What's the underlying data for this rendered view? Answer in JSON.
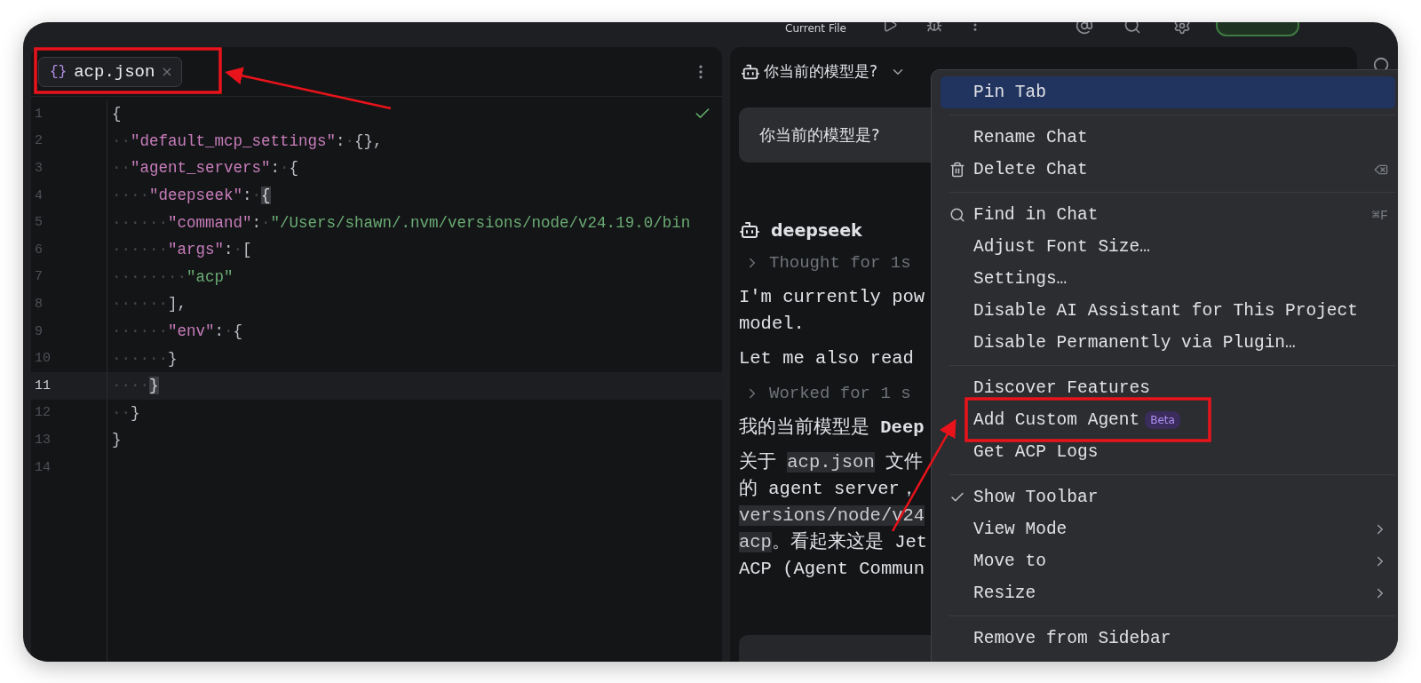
{
  "toolbar": {
    "run_config": "Current File"
  },
  "editor": {
    "tab": {
      "icon": "{}",
      "label": "acp.json",
      "selected": true
    },
    "lines": [
      {
        "number": "1",
        "current": false,
        "tokens": [
          {
            "kind": "punct",
            "text": "{"
          }
        ]
      },
      {
        "number": "2",
        "current": false,
        "tokens": [
          {
            "kind": "ws",
            "text": "··"
          },
          {
            "kind": "key",
            "text": "\"default_mcp_settings\""
          },
          {
            "kind": "punct",
            "text": ":"
          },
          {
            "kind": "ws",
            "text": "·"
          },
          {
            "kind": "punct",
            "text": "{},"
          }
        ]
      },
      {
        "number": "3",
        "current": false,
        "tokens": [
          {
            "kind": "ws",
            "text": "··"
          },
          {
            "kind": "key",
            "text": "\"agent_servers\""
          },
          {
            "kind": "punct",
            "text": ":"
          },
          {
            "kind": "ws",
            "text": "·"
          },
          {
            "kind": "punct",
            "text": "{"
          }
        ]
      },
      {
        "number": "4",
        "current": false,
        "tokens": [
          {
            "kind": "ws",
            "text": "····"
          },
          {
            "kind": "key",
            "text": "\"deepseek\""
          },
          {
            "kind": "punct",
            "text": ":"
          },
          {
            "kind": "ws",
            "text": "·"
          },
          {
            "kind": "match",
            "text": "{"
          }
        ]
      },
      {
        "number": "5",
        "current": false,
        "tokens": [
          {
            "kind": "ws",
            "text": "······"
          },
          {
            "kind": "key",
            "text": "\"command\""
          },
          {
            "kind": "punct",
            "text": ":"
          },
          {
            "kind": "ws",
            "text": "·"
          },
          {
            "kind": "string",
            "text": "\"/Users/shawn/.nvm/versions/node/v24.19.0/bin"
          }
        ]
      },
      {
        "number": "6",
        "current": false,
        "tokens": [
          {
            "kind": "ws",
            "text": "······"
          },
          {
            "kind": "key",
            "text": "\"args\""
          },
          {
            "kind": "punct",
            "text": ":"
          },
          {
            "kind": "ws",
            "text": "·"
          },
          {
            "kind": "punct",
            "text": "["
          }
        ]
      },
      {
        "number": "7",
        "current": false,
        "tokens": [
          {
            "kind": "ws",
            "text": "········"
          },
          {
            "kind": "string",
            "text": "\"acp\""
          }
        ]
      },
      {
        "number": "8",
        "current": false,
        "tokens": [
          {
            "kind": "ws",
            "text": "······"
          },
          {
            "kind": "punct",
            "text": "],"
          }
        ]
      },
      {
        "number": "9",
        "current": false,
        "tokens": [
          {
            "kind": "ws",
            "text": "······"
          },
          {
            "kind": "key",
            "text": "\"env\""
          },
          {
            "kind": "punct",
            "text": ":"
          },
          {
            "kind": "ws",
            "text": "·"
          },
          {
            "kind": "punct",
            "text": "{"
          }
        ]
      },
      {
        "number": "10",
        "current": false,
        "tokens": [
          {
            "kind": "ws",
            "text": "······"
          },
          {
            "kind": "punct",
            "text": "}"
          }
        ]
      },
      {
        "number": "11",
        "current": true,
        "tokens": [
          {
            "kind": "ws",
            "text": "····"
          },
          {
            "kind": "match",
            "text": "}"
          }
        ]
      },
      {
        "number": "12",
        "current": false,
        "tokens": [
          {
            "kind": "ws",
            "text": "··"
          },
          {
            "kind": "punct",
            "text": "}"
          }
        ]
      },
      {
        "number": "13",
        "current": false,
        "tokens": [
          {
            "kind": "punct",
            "text": "}"
          }
        ]
      },
      {
        "number": "14",
        "current": false
      }
    ]
  },
  "chat": {
    "title": "你当前的模型是?",
    "user_message": "你当前的模型是?",
    "agent": "deepseek",
    "blocks": [
      {
        "kind": "disclosure",
        "text": "Thought for 1s"
      },
      {
        "kind": "paragraph",
        "lines": [
          [
            {
              "text": "I'm currently pow"
            }
          ],
          [
            {
              "text": "model."
            }
          ]
        ]
      },
      {
        "kind": "paragraph",
        "lines": [
          [
            {
              "text": "Let me also read"
            }
          ]
        ]
      },
      {
        "kind": "disclosure",
        "text": "Worked for 1 s"
      },
      {
        "kind": "paragraph",
        "lines": [
          [
            {
              "kind": "plain",
              "text": "我的当前模型是 "
            },
            {
              "kind": "bold",
              "text": "Deep"
            }
          ]
        ]
      },
      {
        "kind": "paragraph",
        "lines": [
          [
            {
              "kind": "plain",
              "text": "关于 "
            },
            {
              "kind": "code",
              "text": "acp.json"
            },
            {
              "kind": "plain",
              "text": " 文件"
            }
          ],
          [
            {
              "kind": "plain",
              "text": "的 agent server，"
            }
          ],
          [
            {
              "kind": "code",
              "text": "versions/node/v24"
            }
          ],
          [
            {
              "kind": "code",
              "text": "acp"
            },
            {
              "kind": "plain",
              "text": "。看起来这是 Jet"
            }
          ],
          [
            {
              "kind": "plain",
              "text": "ACP (Agent Commun"
            }
          ]
        ]
      }
    ]
  },
  "menu": {
    "items": [
      {
        "kind": "item",
        "label": "Pin Tab",
        "selected": true
      },
      {
        "kind": "separator"
      },
      {
        "kind": "item",
        "label": "Rename Chat",
        "selected": false
      },
      {
        "kind": "trash_item",
        "label": "Delete Chat",
        "selected": false
      },
      {
        "kind": "separator"
      },
      {
        "kind": "search_item",
        "label": "Find in Chat",
        "selected": false,
        "shortcut": "⌘F"
      },
      {
        "kind": "item",
        "label": "Adjust Font Size…",
        "selected": false
      },
      {
        "kind": "item",
        "label": "Settings…",
        "selected": false
      },
      {
        "kind": "item",
        "label": "Disable AI Assistant for This Project",
        "selected": false
      },
      {
        "kind": "item",
        "label": "Disable Permanently via Plugin…",
        "selected": false
      },
      {
        "kind": "separator"
      },
      {
        "kind": "item",
        "label": "Discover Features",
        "selected": false
      },
      {
        "kind": "item",
        "label": "Add Custom Agent",
        "selected": false,
        "badge": "Beta"
      },
      {
        "kind": "item",
        "label": "Get ACP Logs",
        "selected": false
      },
      {
        "kind": "separator"
      },
      {
        "kind": "item",
        "label": "Show Toolbar",
        "selected": false,
        "checked": true
      },
      {
        "kind": "submenu_item",
        "label": "View Mode",
        "selected": false
      },
      {
        "kind": "submenu_item",
        "label": "Move to",
        "selected": false
      },
      {
        "kind": "submenu_item",
        "label": "Resize",
        "selected": false
      },
      {
        "kind": "separator"
      },
      {
        "kind": "item",
        "label": "Remove from Sidebar",
        "selected": false
      }
    ]
  }
}
